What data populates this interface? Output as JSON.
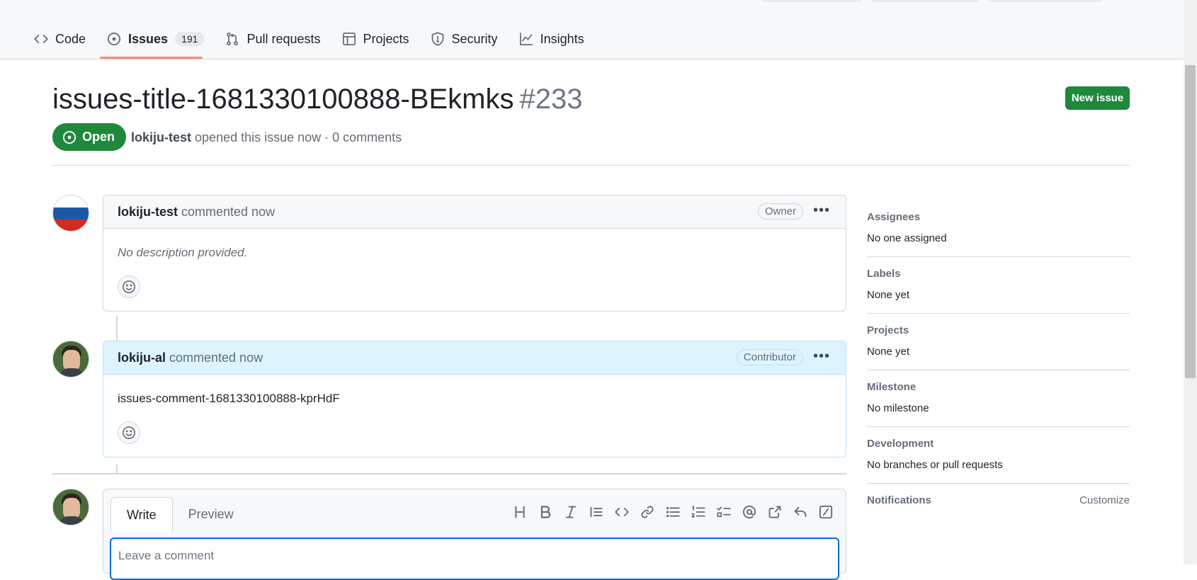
{
  "nav": {
    "tabs": [
      {
        "label": "Code",
        "icon": "code-icon"
      },
      {
        "label": "Issues",
        "icon": "issue-opened-icon",
        "count": "191"
      },
      {
        "label": "Pull requests",
        "icon": "git-pull-request-icon"
      },
      {
        "label": "Projects",
        "icon": "table-icon"
      },
      {
        "label": "Security",
        "icon": "shield-icon"
      },
      {
        "label": "Insights",
        "icon": "graph-icon"
      }
    ]
  },
  "issue": {
    "title": "issues-title-1681330100888-BEkmks",
    "number": "#233",
    "state": "Open",
    "author": "lokiju-test",
    "meta_text": "opened this issue now · 0 comments",
    "new_issue_label": "New issue"
  },
  "comments": [
    {
      "author": "lokiju-test",
      "time": "commented now",
      "role": "Owner",
      "body": "No description provided."
    },
    {
      "author": "lokiju-al",
      "time": "commented now",
      "role": "Contributor",
      "body": "issues-comment-1681330100888-kprHdF"
    }
  ],
  "editor": {
    "tabs": [
      "Write",
      "Preview"
    ],
    "placeholder": "Leave a comment"
  },
  "sidebar": {
    "assignees": {
      "label": "Assignees",
      "value": "No one assigned"
    },
    "labels": {
      "label": "Labels",
      "value": "None yet"
    },
    "projects": {
      "label": "Projects",
      "value": "None yet"
    },
    "milestone": {
      "label": "Milestone",
      "value": "No milestone"
    },
    "development": {
      "label": "Development",
      "value": "No branches or pull requests"
    },
    "notifications": {
      "label": "Notifications",
      "action": "Customize"
    }
  },
  "colors": {
    "open_green": "#1f883d",
    "underline": "#fd8c73",
    "focus_blue": "#0969da"
  }
}
